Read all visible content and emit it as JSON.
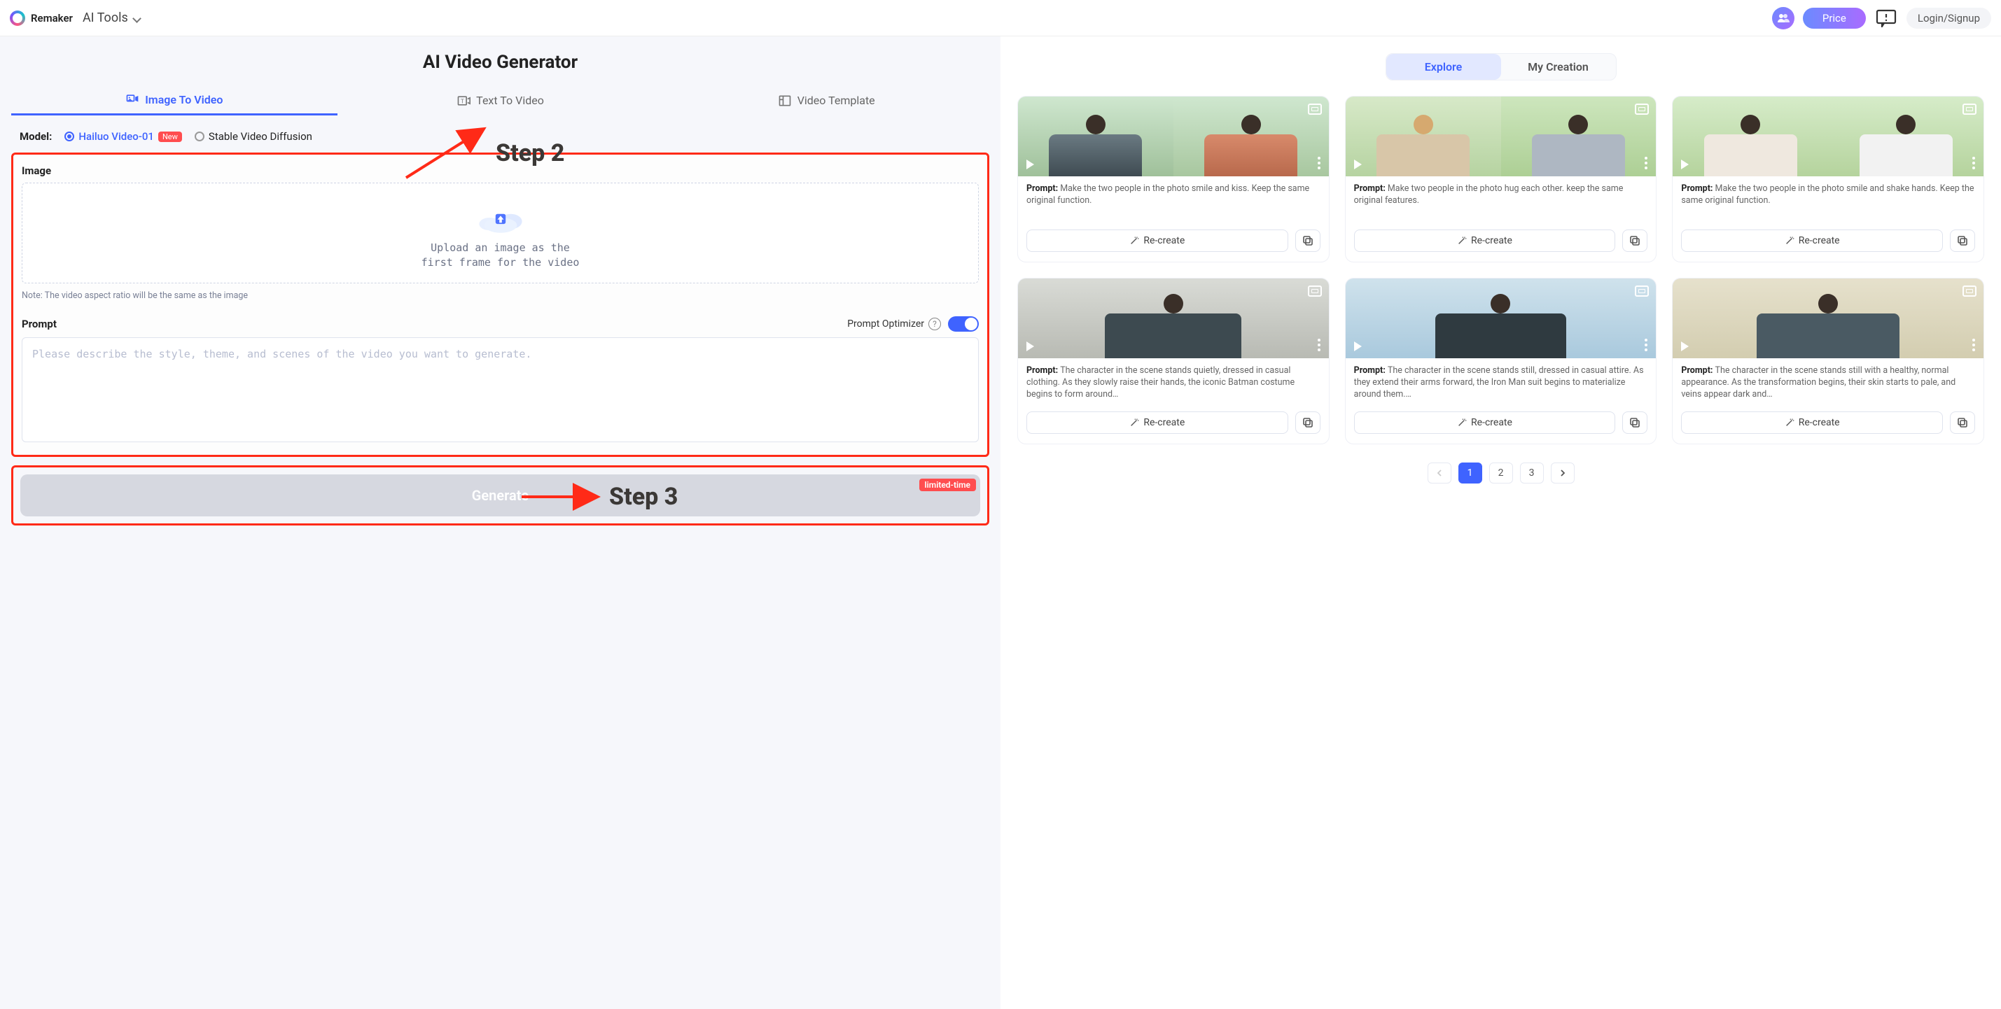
{
  "nav": {
    "brand": "Remaker",
    "ai_tools": "AI Tools",
    "price": "Price",
    "login": "Login/Signup"
  },
  "left": {
    "title": "AI Video Generator",
    "tabs": {
      "image_to_video": "Image To Video",
      "text_to_video": "Text To Video",
      "video_template": "Video Template"
    },
    "model": {
      "label": "Model:",
      "hailuo": "Hailuo Video-01",
      "new_badge": "New",
      "stable": "Stable Video Diffusion"
    },
    "image_section": {
      "label": "Image",
      "upload_line1": "Upload an image as the",
      "upload_line2": "first frame for the video",
      "note": "Note: The video aspect ratio will be the same as the image"
    },
    "prompt_section": {
      "label": "Prompt",
      "optimizer_label": "Prompt Optimizer",
      "placeholder": "Please describe the style, theme, and scenes of the video you want to generate."
    },
    "generate": {
      "label": "Generate",
      "badge": "limited-time"
    }
  },
  "annotations": {
    "step2": "Step 2",
    "step3": "Step 3"
  },
  "right": {
    "tabs": {
      "explore": "Explore",
      "my_creation": "My Creation"
    },
    "prompt_prefix": "Prompt: ",
    "recreate": "Re-create",
    "cards": [
      {
        "text": "Make the two people in the photo smile and kiss. Keep the same original function."
      },
      {
        "text": "Make two people in the photo hug each other. keep the same original features."
      },
      {
        "text": "Make the two people in the photo smile and shake hands. Keep the same original function."
      },
      {
        "text": "The character in the scene stands quietly, dressed in casual clothing. As they slowly raise their hands, the iconic Batman costume begins to form around…"
      },
      {
        "text": "The character in the scene stands still, dressed in casual attire. As they extend their arms forward, the Iron Man suit begins to materialize around them.…"
      },
      {
        "text": "The character in the scene stands still with a healthy, normal appearance. As the transformation begins, their skin starts to pale, and veins appear dark and…"
      }
    ],
    "pagination": {
      "pages": [
        "1",
        "2",
        "3"
      ],
      "active": "1"
    }
  },
  "colors": {
    "accent": "#3f63ff",
    "danger": "#ff4d4f",
    "annotation": "#ff2a17"
  }
}
